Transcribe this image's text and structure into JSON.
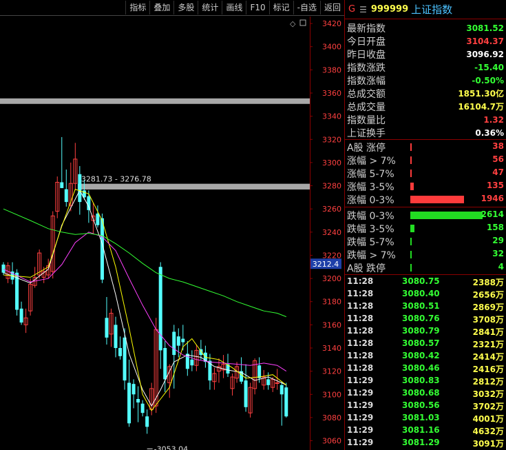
{
  "toolbar": {
    "items": [
      "指标",
      "叠加",
      "多股",
      "统计",
      "画线",
      "F10",
      "标记",
      "-自选",
      "返回"
    ]
  },
  "header": {
    "marker": "G",
    "menu_icon": "☰",
    "code": "999999",
    "name": "上证指数"
  },
  "quote": [
    {
      "label": "最新指数",
      "value": "3081.52",
      "color": "green"
    },
    {
      "label": "今日开盘",
      "value": "3104.37",
      "color": "red"
    },
    {
      "label": "昨日收盘",
      "value": "3096.92",
      "color": "white"
    },
    {
      "label": "指数涨跌",
      "value": "-15.40",
      "color": "green"
    },
    {
      "label": "指数涨幅",
      "value": "-0.50%",
      "color": "green"
    },
    {
      "label": "总成交额",
      "value": "1851.30亿",
      "color": "yellow"
    },
    {
      "label": "总成交量",
      "value": "16104.7万",
      "color": "yellow"
    },
    {
      "label": "指数量比",
      "value": "1.32",
      "color": "red"
    },
    {
      "label": "上证换手",
      "value": "0.36%",
      "color": "white"
    }
  ],
  "distribution": [
    {
      "label": "A股 涨停",
      "value": "38",
      "count": 38,
      "dir": "up"
    },
    {
      "label": "涨幅 > 7%",
      "value": "56",
      "count": 56,
      "dir": "up"
    },
    {
      "label": "涨幅 5-7%",
      "value": "47",
      "count": 47,
      "dir": "up"
    },
    {
      "label": "涨幅 3-5%",
      "value": "135",
      "count": 135,
      "dir": "up"
    },
    {
      "label": "涨幅 0-3%",
      "value": "1946",
      "count": 1946,
      "dir": "up"
    },
    {
      "label": "跌幅 0-3%",
      "value": "2614",
      "count": 2614,
      "dir": "down"
    },
    {
      "label": "跌幅 3-5%",
      "value": "158",
      "count": 158,
      "dir": "down"
    },
    {
      "label": "跌幅 5-7%",
      "value": "29",
      "count": 29,
      "dir": "down"
    },
    {
      "label": "跌幅 > 7%",
      "value": "32",
      "count": 32,
      "dir": "down"
    },
    {
      "label": "A股 跌停",
      "value": "4",
      "count": 4,
      "dir": "down"
    }
  ],
  "ticks": [
    {
      "time": "11:28",
      "price": "3080.75",
      "volume": "2388万"
    },
    {
      "time": "11:28",
      "price": "3080.40",
      "volume": "2656万"
    },
    {
      "time": "11:28",
      "price": "3080.51",
      "volume": "2869万"
    },
    {
      "time": "11:28",
      "price": "3080.76",
      "volume": "3708万"
    },
    {
      "time": "11:28",
      "price": "3080.79",
      "volume": "2841万"
    },
    {
      "time": "11:28",
      "price": "3080.57",
      "volume": "2321万"
    },
    {
      "time": "11:28",
      "price": "3080.42",
      "volume": "2414万"
    },
    {
      "time": "11:28",
      "price": "3080.46",
      "volume": "2416万"
    },
    {
      "time": "11:29",
      "price": "3080.83",
      "volume": "2812万"
    },
    {
      "time": "11:29",
      "price": "3080.68",
      "volume": "3032万"
    },
    {
      "time": "11:29",
      "price": "3080.56",
      "volume": "3702万"
    },
    {
      "time": "11:29",
      "price": "3081.03",
      "volume": "4001万"
    },
    {
      "time": "11:29",
      "price": "3081.16",
      "volume": "4632万"
    },
    {
      "time": "11:29",
      "price": "3081.29",
      "volume": "3091万"
    }
  ],
  "chart_data": {
    "type": "candlestick",
    "yaxis_ticks": [
      3060,
      3080,
      3100,
      3120,
      3140,
      3160,
      3180,
      3200,
      3220,
      3240,
      3260,
      3280,
      3300,
      3320,
      3340,
      3360,
      3380,
      3400,
      3420
    ],
    "ylim": [
      3052,
      3426
    ],
    "current_price_label": "3212.4",
    "current_price": 3212.4,
    "zone_annotation": "3281.73 - 3276.78",
    "zone_low": 3276.78,
    "zone_high": 3281.73,
    "upper_band_price": 3353,
    "low_annotation": "3053.04",
    "low_price": 3053.04,
    "up_color": "#ff4040",
    "down_color": "#54ffff",
    "candles": [
      [
        3212,
        3214,
        3203,
        3205
      ],
      [
        3200,
        3214,
        3196,
        3211
      ],
      [
        3206,
        3214,
        3195,
        3199
      ],
      [
        3205,
        3208,
        3168,
        3173
      ],
      [
        3174,
        3180,
        3160,
        3162
      ],
      [
        3160,
        3174,
        3153,
        3166
      ],
      [
        3172,
        3200,
        3168,
        3195
      ],
      [
        3194,
        3210,
        3192,
        3201
      ],
      [
        3203,
        3225,
        3200,
        3222
      ],
      [
        3201,
        3210,
        3196,
        3206
      ],
      [
        3203,
        3217,
        3200,
        3211
      ],
      [
        3206,
        3258,
        3200,
        3254
      ],
      [
        3258,
        3288,
        3252,
        3283
      ],
      [
        3283,
        3322,
        3278,
        3278
      ],
      [
        3277,
        3294,
        3262,
        3266
      ],
      [
        3263,
        3300,
        3258,
        3282
      ],
      [
        3282,
        3317,
        3276,
        3303
      ],
      [
        3290,
        3297,
        3255,
        3266
      ],
      [
        3276,
        3285,
        3268,
        3270
      ],
      [
        3271,
        3276,
        3248,
        3259
      ],
      [
        3250,
        3265,
        3239,
        3254
      ],
      [
        3256,
        3263,
        3244,
        3246
      ],
      [
        3252,
        3256,
        3196,
        3199
      ],
      [
        3166,
        3184,
        3143,
        3149
      ],
      [
        3152,
        3174,
        3141,
        3170
      ],
      [
        3160,
        3167,
        3132,
        3140
      ],
      [
        3140,
        3150,
        3130,
        3133
      ],
      [
        3149,
        3157,
        3104,
        3112
      ],
      [
        3110,
        3130,
        3072,
        3075
      ],
      [
        3109,
        3113,
        3088,
        3100
      ],
      [
        3096,
        3107,
        3076,
        3093
      ],
      [
        3092,
        3095,
        3081,
        3084
      ],
      [
        3081,
        3087,
        3066,
        3072
      ],
      [
        3087,
        3110,
        3082,
        3105
      ],
      [
        3090,
        3166,
        3084,
        3156
      ],
      [
        3210,
        3214,
        3122,
        3138
      ],
      [
        3140,
        3146,
        3102,
        3113
      ],
      [
        3110,
        3126,
        3097,
        3124
      ],
      [
        3154,
        3160,
        3105,
        3134
      ],
      [
        3150,
        3157,
        3132,
        3142
      ],
      [
        3148,
        3160,
        3138,
        3145
      ],
      [
        3135,
        3146,
        3116,
        3122
      ],
      [
        3130,
        3138,
        3120,
        3125
      ],
      [
        3125,
        3143,
        3120,
        3138
      ],
      [
        3139,
        3147,
        3130,
        3134
      ],
      [
        3136,
        3142,
        3123,
        3128
      ],
      [
        3129,
        3135,
        3104,
        3112
      ],
      [
        3111,
        3123,
        3104,
        3118
      ],
      [
        3120,
        3131,
        3110,
        3124
      ],
      [
        3121,
        3134,
        3114,
        3126
      ],
      [
        3126,
        3135,
        3115,
        3118
      ],
      [
        3105,
        3118,
        3099,
        3115
      ],
      [
        3114,
        3128,
        3110,
        3124
      ],
      [
        3120,
        3132,
        3109,
        3111
      ],
      [
        3112,
        3126,
        3085,
        3089
      ],
      [
        3084,
        3110,
        3080,
        3106
      ],
      [
        3105,
        3131,
        3100,
        3129
      ],
      [
        3125,
        3132,
        3110,
        3114
      ],
      [
        3108,
        3121,
        3104,
        3115
      ],
      [
        3113,
        3119,
        3104,
        3108
      ],
      [
        3106,
        3115,
        3102,
        3113
      ],
      [
        3110,
        3122,
        3104,
        3110
      ],
      [
        3108,
        3111,
        3073,
        3100
      ],
      [
        3106,
        3110,
        3080,
        3081
      ]
    ],
    "ma_lines": [
      {
        "color": "#ffffff",
        "points": [
          [
            0,
            3205
          ],
          [
            6,
            3196
          ],
          [
            10,
            3208
          ],
          [
            13,
            3246
          ],
          [
            17,
            3276
          ],
          [
            19,
            3262
          ],
          [
            22,
            3230
          ],
          [
            25,
            3186
          ],
          [
            28,
            3135
          ],
          [
            31,
            3104
          ],
          [
            33,
            3090
          ],
          [
            35,
            3104
          ],
          [
            38,
            3128
          ],
          [
            41,
            3134
          ],
          [
            44,
            3132
          ],
          [
            47,
            3124
          ],
          [
            50,
            3121
          ],
          [
            53,
            3119
          ],
          [
            56,
            3112
          ],
          [
            59,
            3115
          ],
          [
            62,
            3110
          ],
          [
            63,
            3108
          ]
        ]
      },
      {
        "color": "#ffff00",
        "points": [
          [
            0,
            3203
          ],
          [
            6,
            3201
          ],
          [
            10,
            3210
          ],
          [
            13,
            3245
          ],
          [
            16,
            3277
          ],
          [
            19,
            3273
          ],
          [
            22,
            3250
          ],
          [
            25,
            3210
          ],
          [
            28,
            3157
          ],
          [
            31,
            3100
          ],
          [
            33,
            3086
          ],
          [
            35,
            3096
          ],
          [
            37,
            3106
          ],
          [
            40,
            3141
          ],
          [
            42,
            3148
          ],
          [
            45,
            3132
          ],
          [
            48,
            3130
          ],
          [
            51,
            3123
          ],
          [
            54,
            3114
          ],
          [
            57,
            3115
          ],
          [
            60,
            3117
          ],
          [
            63,
            3108
          ]
        ]
      },
      {
        "color": "#ff40ff",
        "points": [
          [
            0,
            3208
          ],
          [
            6,
            3197
          ],
          [
            10,
            3200
          ],
          [
            13,
            3212
          ],
          [
            16,
            3231
          ],
          [
            19,
            3240
          ],
          [
            22,
            3236
          ],
          [
            25,
            3224
          ],
          [
            28,
            3200
          ],
          [
            31,
            3177
          ],
          [
            34,
            3156
          ],
          [
            37,
            3142
          ],
          [
            40,
            3134
          ],
          [
            43,
            3130
          ],
          [
            46,
            3128
          ],
          [
            49,
            3127
          ],
          [
            52,
            3126
          ],
          [
            55,
            3125
          ],
          [
            58,
            3127
          ],
          [
            61,
            3125
          ],
          [
            63,
            3120
          ]
        ]
      },
      {
        "color": "#33ff33",
        "points": [
          [
            0,
            3260
          ],
          [
            6,
            3250
          ],
          [
            10,
            3243
          ],
          [
            13,
            3240
          ],
          [
            16,
            3238
          ],
          [
            19,
            3239
          ],
          [
            22,
            3237
          ],
          [
            25,
            3230
          ],
          [
            28,
            3222
          ],
          [
            31,
            3213
          ],
          [
            34,
            3205
          ],
          [
            37,
            3200
          ],
          [
            40,
            3197
          ],
          [
            43,
            3193
          ],
          [
            46,
            3189
          ],
          [
            49,
            3185
          ],
          [
            52,
            3180
          ],
          [
            55,
            3176
          ],
          [
            58,
            3172
          ],
          [
            61,
            3170
          ],
          [
            63,
            3167
          ]
        ]
      }
    ]
  }
}
